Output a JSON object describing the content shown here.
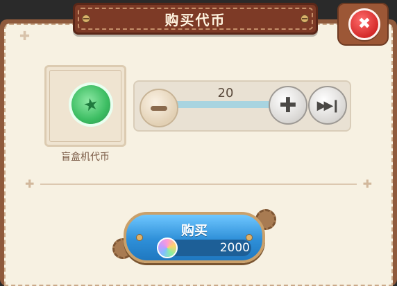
{
  "dialog": {
    "title": "购买代币",
    "close_icon": "close-icon"
  },
  "item": {
    "name": "盲盒机代币",
    "icon": "green-chip-coin-icon"
  },
  "quantity": {
    "value": "20",
    "decrease_icon": "minus-icon",
    "increase_icon": "plus-icon",
    "max_icon": "fast-forward-icon"
  },
  "buy": {
    "label": "购买",
    "price": "2000",
    "currency_icon": "rainbow-gem-icon"
  },
  "colors": {
    "frame": "#8f5a3c",
    "panel_bg": "#f7f1e2",
    "title_banner": "#7d3a26",
    "close_red": "#d42a2a",
    "buy_blue": "#2e8fd8",
    "coin_green": "#3cbd62"
  }
}
